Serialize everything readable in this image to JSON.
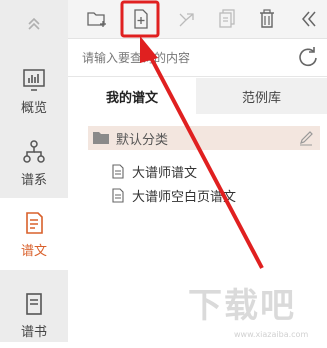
{
  "sidebar": {
    "collapse_icon": "chevron-up-double-icon",
    "items": [
      {
        "label": "概览",
        "icon": "chart-icon"
      },
      {
        "label": "谱系",
        "icon": "tree-icon"
      },
      {
        "label": "谱文",
        "icon": "document-icon",
        "active": true
      },
      {
        "label": "谱书",
        "icon": "book-icon"
      }
    ]
  },
  "toolbar": {
    "buttons": [
      "new-folder-icon",
      "new-file-icon",
      "move-icon",
      "copy-icon",
      "trash-icon",
      "collapse-left-icon"
    ]
  },
  "search": {
    "placeholder": "请输入要查询的内容",
    "value": ""
  },
  "tabs": [
    {
      "label": "我的谱文",
      "active": true
    },
    {
      "label": "范例库",
      "active": false
    }
  ],
  "tree": {
    "folder": "默认分类",
    "docs": [
      "大谱师谱文",
      "大谱师空白页谱文"
    ]
  },
  "watermark": {
    "text": "下载吧",
    "url": "www.xiazaiba.com"
  },
  "colors": {
    "accent": "#d9602b",
    "annotation_red": "#e02020",
    "sidebar_bg": "#ececec",
    "folder_row_bg": "#f3e6df"
  }
}
